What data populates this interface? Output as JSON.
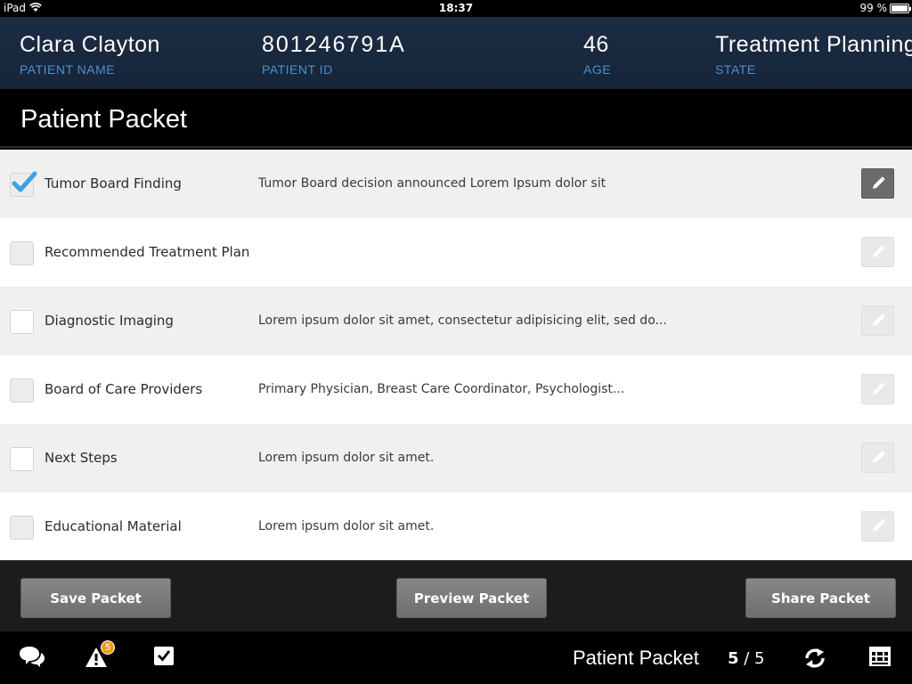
{
  "status": {
    "carrier": "iPad",
    "time": "18:37",
    "battery": "99 %"
  },
  "patient": {
    "name": "Clara Clayton",
    "name_label": "PATIENT NAME",
    "id": "801246791A",
    "id_label": "PATIENT ID",
    "age": "46",
    "age_label": "AGE",
    "state": "Treatment Planning",
    "state_label": "STATE"
  },
  "page_title": "Patient Packet",
  "items": [
    {
      "name": "Tumor Board Finding",
      "description": "Tumor Board decision announced Lorem Ipsum dolor sit",
      "checked": true
    },
    {
      "name": "Recommended Treatment Plan",
      "description": "",
      "checked": false
    },
    {
      "name": "Diagnostic Imaging",
      "description": "Lorem ipsum dolor sit amet, consectetur adipisicing elit, sed do...",
      "checked": false
    },
    {
      "name": "Board of Care Providers",
      "description": "Primary Physician, Breast Care Coordinator, Psychologist...",
      "checked": false
    },
    {
      "name": "Next Steps",
      "description": "Lorem ipsum dolor sit amet.",
      "checked": false
    },
    {
      "name": "Educational Material",
      "description": "Lorem ipsum dolor sit amet.",
      "checked": false
    }
  ],
  "actions": {
    "save": "Save Packet",
    "preview": "Preview Packet",
    "share": "Share Packet"
  },
  "bottom": {
    "title": "Patient Packet",
    "page_current": "5",
    "page_sep": " / ",
    "page_total": "5",
    "alert_count": "5"
  },
  "colors": {
    "header_bg": "#1c2c42",
    "label_blue": "#4d8fcf",
    "check_blue": "#3aa3e3",
    "badge": "#f39c12"
  },
  "icons": [
    "wifi-icon",
    "battery-icon",
    "check-icon",
    "pencil-icon",
    "chat-icon",
    "alert-icon",
    "checkbox-icon",
    "sync-icon",
    "grid-icon"
  ]
}
